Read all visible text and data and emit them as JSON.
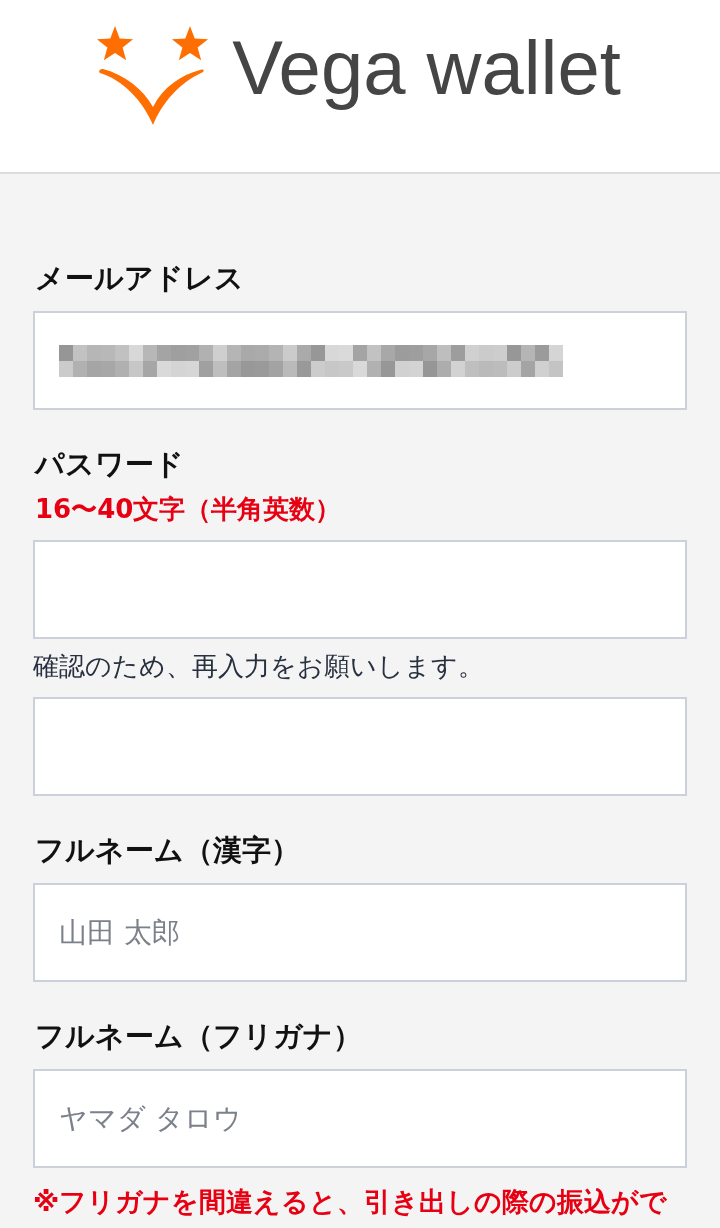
{
  "header": {
    "logo_text": "Vega wallet"
  },
  "form": {
    "items": [
      {
        "kind": "label",
        "text": "メールアドレス"
      },
      {
        "kind": "input",
        "redacted": true
      },
      {
        "kind": "label",
        "text": "パスワード"
      },
      {
        "kind": "hint",
        "text": "16〜40文字（半角英数）"
      },
      {
        "kind": "input",
        "redacted": false
      },
      {
        "kind": "note",
        "text": "確認のため、再入力をお願いします。"
      },
      {
        "kind": "input",
        "redacted": false
      },
      {
        "kind": "label",
        "text": "フルネーム（漢字）"
      },
      {
        "kind": "input",
        "placeholder": "山田 太郎",
        "redacted": false
      },
      {
        "kind": "label",
        "text": "フルネーム（フリガナ）"
      },
      {
        "kind": "input",
        "placeholder": "ヤマダ タロウ",
        "redacted": false
      },
      {
        "kind": "warning",
        "text": "※フリガナを間違えると、引き出しの際の振込がで"
      }
    ]
  }
}
